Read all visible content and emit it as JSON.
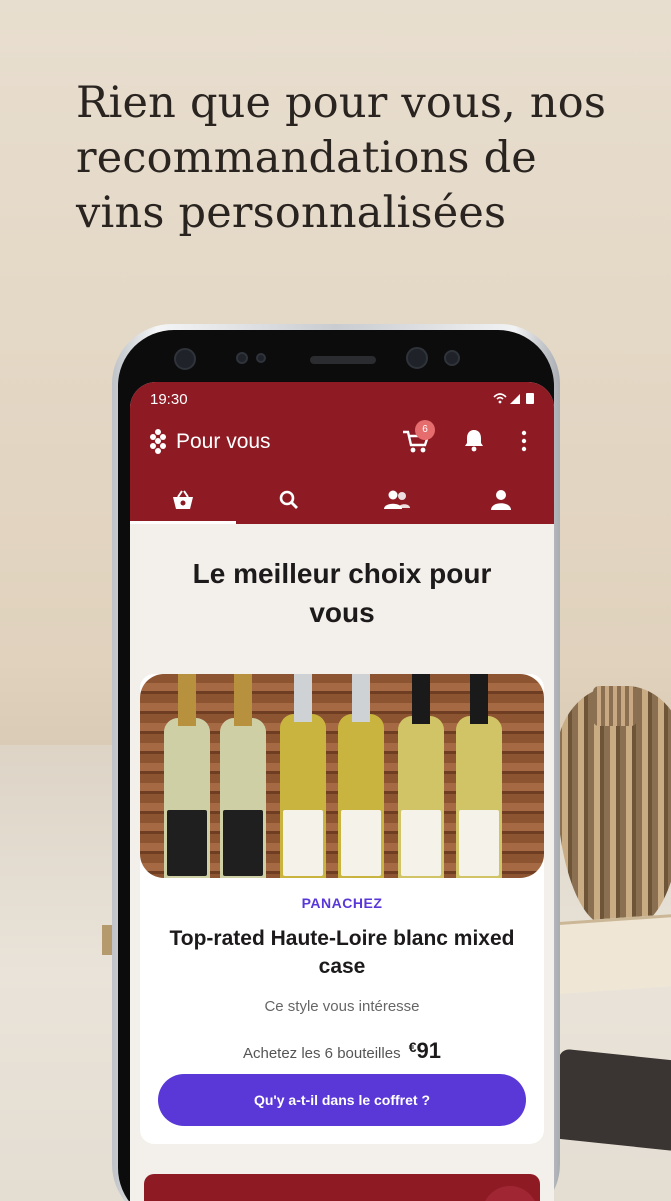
{
  "headline": "Rien que pour vous, nos recommandations de vins personnalisées",
  "status_bar": {
    "time": "19:30",
    "icons": "▾ᵢ◢▮"
  },
  "app_bar": {
    "title": "Pour vous",
    "cart_count": "6"
  },
  "tabs": [
    {
      "name": "shop",
      "icon": "basket-icon",
      "active": true
    },
    {
      "name": "search",
      "icon": "search-icon",
      "active": false
    },
    {
      "name": "community",
      "icon": "people-icon",
      "active": false
    },
    {
      "name": "profile",
      "icon": "person-icon",
      "active": false
    }
  ],
  "section_title": "Le meilleur choix pour vous",
  "offer": {
    "eyebrow": "PANACHEZ",
    "name": "Top-rated Haute-Loire blanc mixed case",
    "subtitle": "Ce style vous intéresse",
    "price_label": "Achetez les 6 bouteilles",
    "price_currency": "€",
    "price_value": "91",
    "cta_label": "Qu'y a-t-il dans le coffret ?"
  },
  "colors": {
    "brand": "#8e1b24",
    "accent": "#5a38d8"
  }
}
